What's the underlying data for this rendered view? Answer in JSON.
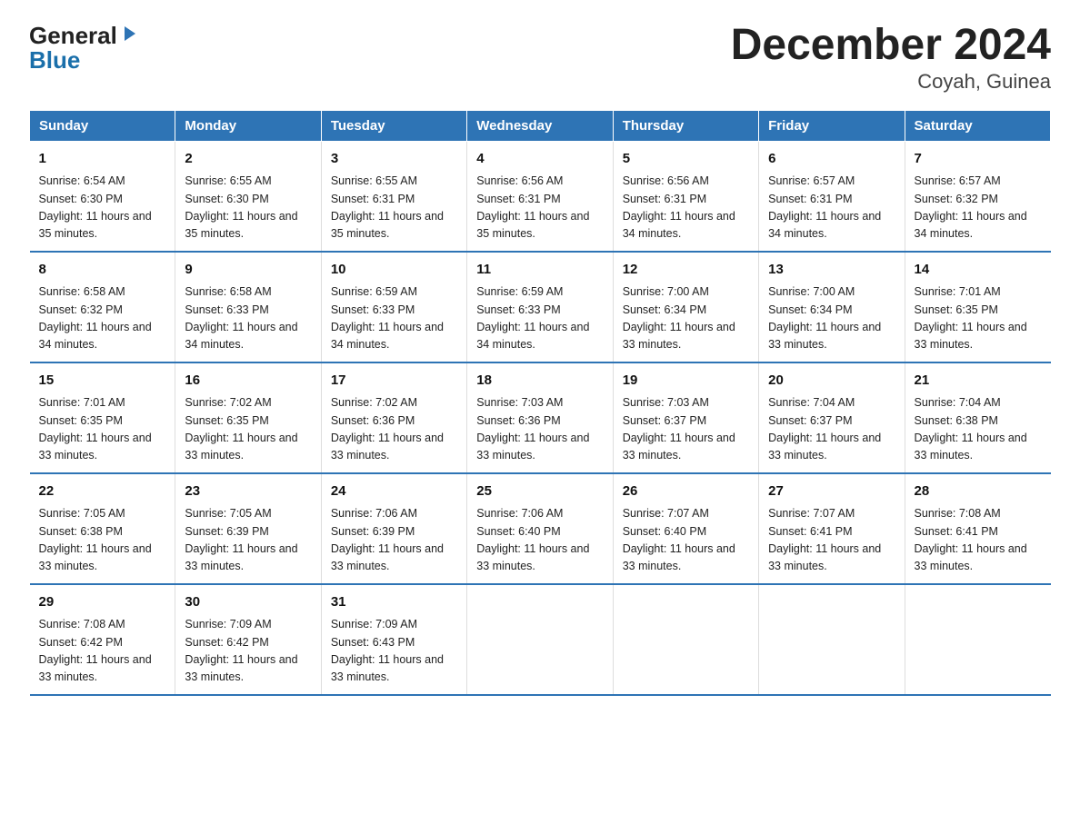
{
  "header": {
    "title": "December 2024",
    "subtitle": "Coyah, Guinea",
    "logo_general": "General",
    "logo_blue": "Blue"
  },
  "columns": [
    "Sunday",
    "Monday",
    "Tuesday",
    "Wednesday",
    "Thursday",
    "Friday",
    "Saturday"
  ],
  "weeks": [
    [
      {
        "day": "1",
        "sunrise": "6:54 AM",
        "sunset": "6:30 PM",
        "daylight": "11 hours and 35 minutes."
      },
      {
        "day": "2",
        "sunrise": "6:55 AM",
        "sunset": "6:30 PM",
        "daylight": "11 hours and 35 minutes."
      },
      {
        "day": "3",
        "sunrise": "6:55 AM",
        "sunset": "6:31 PM",
        "daylight": "11 hours and 35 minutes."
      },
      {
        "day": "4",
        "sunrise": "6:56 AM",
        "sunset": "6:31 PM",
        "daylight": "11 hours and 35 minutes."
      },
      {
        "day": "5",
        "sunrise": "6:56 AM",
        "sunset": "6:31 PM",
        "daylight": "11 hours and 34 minutes."
      },
      {
        "day": "6",
        "sunrise": "6:57 AM",
        "sunset": "6:31 PM",
        "daylight": "11 hours and 34 minutes."
      },
      {
        "day": "7",
        "sunrise": "6:57 AM",
        "sunset": "6:32 PM",
        "daylight": "11 hours and 34 minutes."
      }
    ],
    [
      {
        "day": "8",
        "sunrise": "6:58 AM",
        "sunset": "6:32 PM",
        "daylight": "11 hours and 34 minutes."
      },
      {
        "day": "9",
        "sunrise": "6:58 AM",
        "sunset": "6:33 PM",
        "daylight": "11 hours and 34 minutes."
      },
      {
        "day": "10",
        "sunrise": "6:59 AM",
        "sunset": "6:33 PM",
        "daylight": "11 hours and 34 minutes."
      },
      {
        "day": "11",
        "sunrise": "6:59 AM",
        "sunset": "6:33 PM",
        "daylight": "11 hours and 34 minutes."
      },
      {
        "day": "12",
        "sunrise": "7:00 AM",
        "sunset": "6:34 PM",
        "daylight": "11 hours and 33 minutes."
      },
      {
        "day": "13",
        "sunrise": "7:00 AM",
        "sunset": "6:34 PM",
        "daylight": "11 hours and 33 minutes."
      },
      {
        "day": "14",
        "sunrise": "7:01 AM",
        "sunset": "6:35 PM",
        "daylight": "11 hours and 33 minutes."
      }
    ],
    [
      {
        "day": "15",
        "sunrise": "7:01 AM",
        "sunset": "6:35 PM",
        "daylight": "11 hours and 33 minutes."
      },
      {
        "day": "16",
        "sunrise": "7:02 AM",
        "sunset": "6:35 PM",
        "daylight": "11 hours and 33 minutes."
      },
      {
        "day": "17",
        "sunrise": "7:02 AM",
        "sunset": "6:36 PM",
        "daylight": "11 hours and 33 minutes."
      },
      {
        "day": "18",
        "sunrise": "7:03 AM",
        "sunset": "6:36 PM",
        "daylight": "11 hours and 33 minutes."
      },
      {
        "day": "19",
        "sunrise": "7:03 AM",
        "sunset": "6:37 PM",
        "daylight": "11 hours and 33 minutes."
      },
      {
        "day": "20",
        "sunrise": "7:04 AM",
        "sunset": "6:37 PM",
        "daylight": "11 hours and 33 minutes."
      },
      {
        "day": "21",
        "sunrise": "7:04 AM",
        "sunset": "6:38 PM",
        "daylight": "11 hours and 33 minutes."
      }
    ],
    [
      {
        "day": "22",
        "sunrise": "7:05 AM",
        "sunset": "6:38 PM",
        "daylight": "11 hours and 33 minutes."
      },
      {
        "day": "23",
        "sunrise": "7:05 AM",
        "sunset": "6:39 PM",
        "daylight": "11 hours and 33 minutes."
      },
      {
        "day": "24",
        "sunrise": "7:06 AM",
        "sunset": "6:39 PM",
        "daylight": "11 hours and 33 minutes."
      },
      {
        "day": "25",
        "sunrise": "7:06 AM",
        "sunset": "6:40 PM",
        "daylight": "11 hours and 33 minutes."
      },
      {
        "day": "26",
        "sunrise": "7:07 AM",
        "sunset": "6:40 PM",
        "daylight": "11 hours and 33 minutes."
      },
      {
        "day": "27",
        "sunrise": "7:07 AM",
        "sunset": "6:41 PM",
        "daylight": "11 hours and 33 minutes."
      },
      {
        "day": "28",
        "sunrise": "7:08 AM",
        "sunset": "6:41 PM",
        "daylight": "11 hours and 33 minutes."
      }
    ],
    [
      {
        "day": "29",
        "sunrise": "7:08 AM",
        "sunset": "6:42 PM",
        "daylight": "11 hours and 33 minutes."
      },
      {
        "day": "30",
        "sunrise": "7:09 AM",
        "sunset": "6:42 PM",
        "daylight": "11 hours and 33 minutes."
      },
      {
        "day": "31",
        "sunrise": "7:09 AM",
        "sunset": "6:43 PM",
        "daylight": "11 hours and 33 minutes."
      },
      null,
      null,
      null,
      null
    ]
  ]
}
